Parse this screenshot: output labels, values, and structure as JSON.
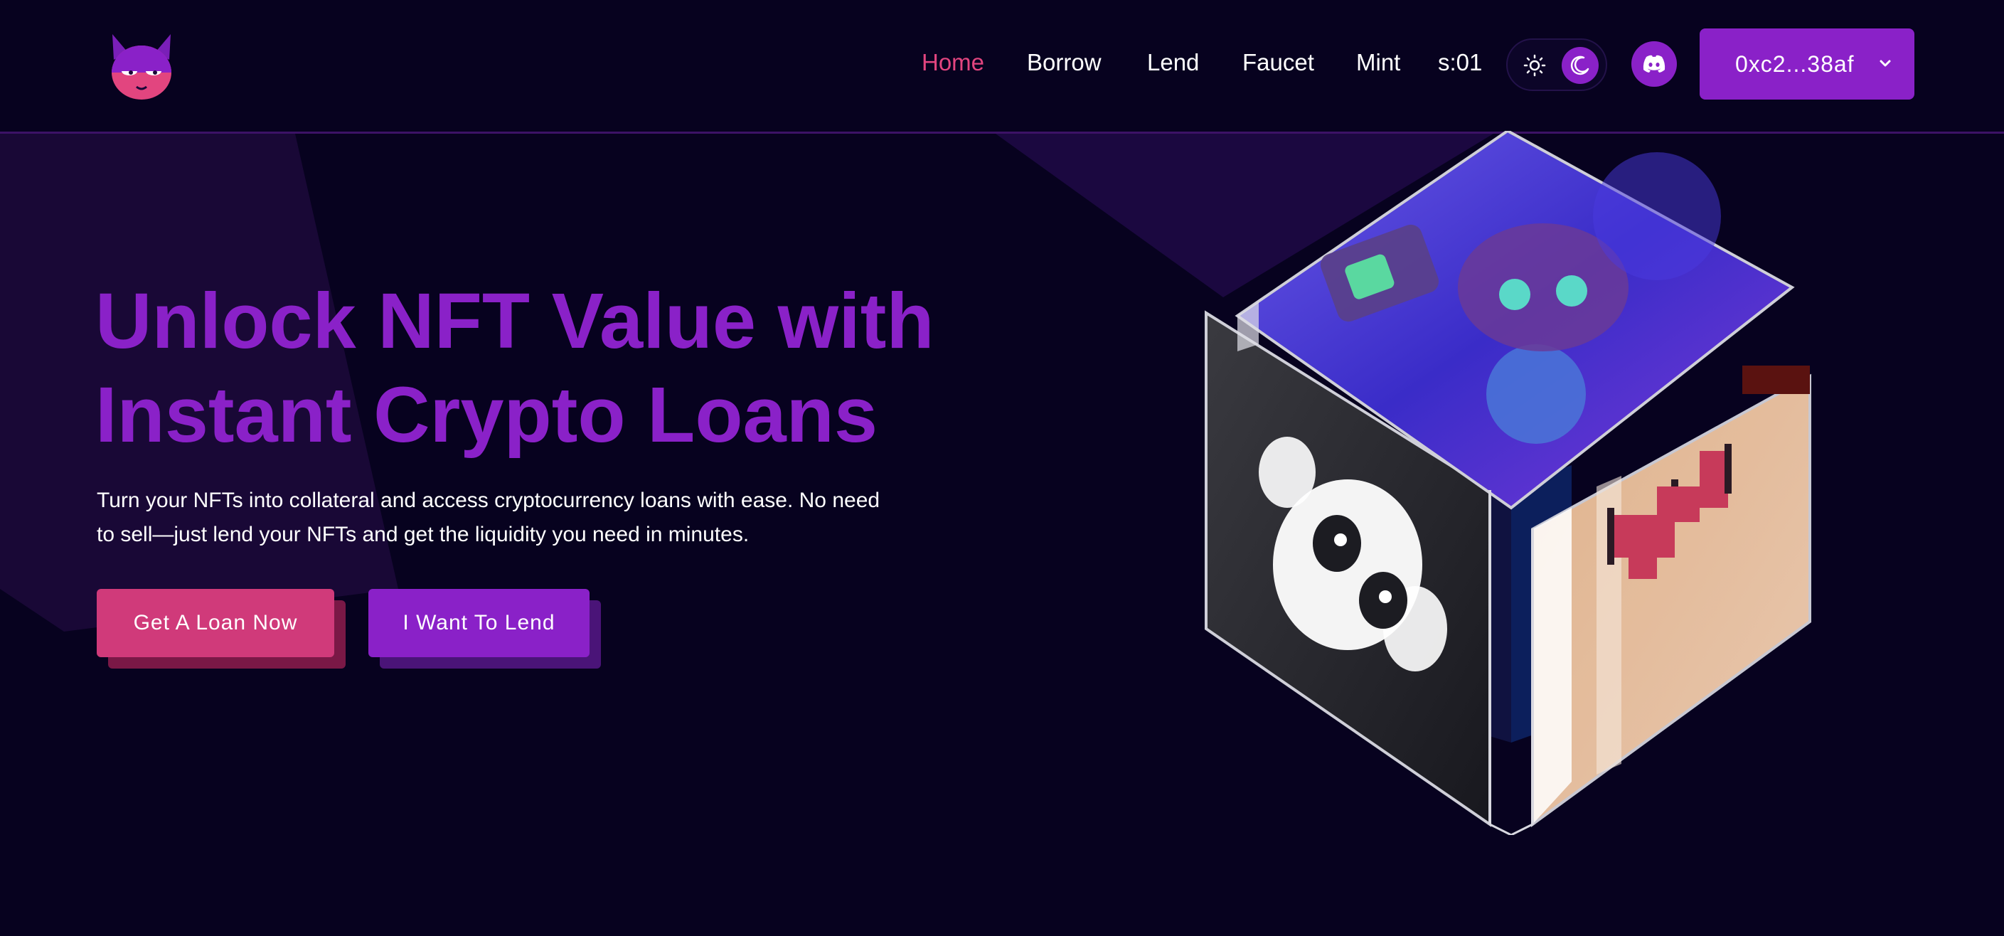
{
  "nav": {
    "items": [
      {
        "label": "Home",
        "active": true
      },
      {
        "label": "Borrow",
        "active": false
      },
      {
        "label": "Lend",
        "active": false
      },
      {
        "label": "Faucet",
        "active": false
      },
      {
        "label": "Mint",
        "active": false
      }
    ],
    "countdown": "s:01"
  },
  "theme_toggle": {
    "options": [
      "sun-icon",
      "moon-icon"
    ],
    "selected": "moon-icon"
  },
  "discord": {
    "icon": "discord-icon"
  },
  "wallet": {
    "label": "0xc2...38af",
    "icon": "chevron-down-icon"
  },
  "hero": {
    "title_line1": "Unlock NFT Value with",
    "title_line2": "Instant Crypto Loans",
    "description": "Turn your NFTs into collateral and access cryptocurrency loans with ease. No need to sell—just lend your NFTs and get the liquidity you need in minutes.",
    "cta_primary": "Get A Loan Now",
    "cta_secondary": "I Want To Lend"
  },
  "colors": {
    "background": "#07021f",
    "accent_purple": "#8a21c8",
    "accent_pink": "#d03a7a",
    "active_nav": "#e2457f"
  }
}
